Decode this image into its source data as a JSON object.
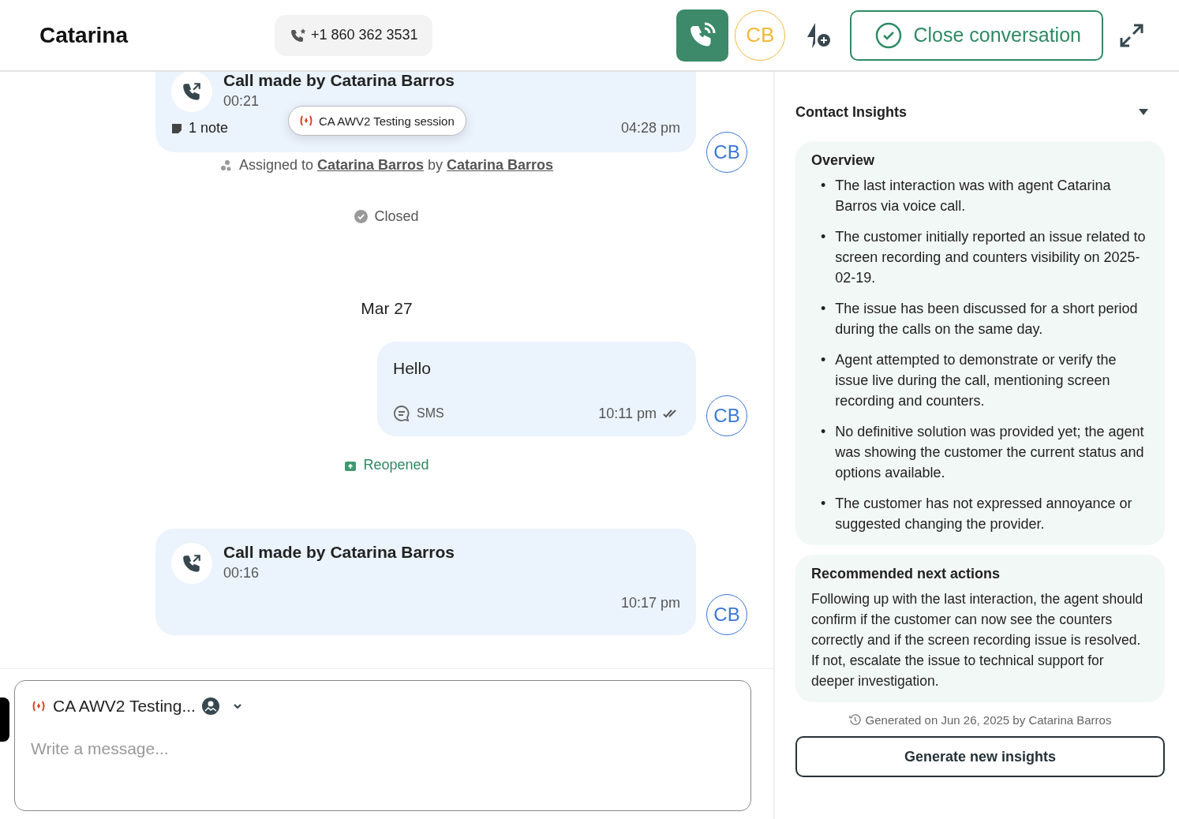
{
  "header": {
    "title": "Catarina",
    "phone": "+1 860 362 3531",
    "call_active": true,
    "agent_initials": "CB",
    "close_button": "Close conversation"
  },
  "timeline": [
    {
      "kind": "call",
      "title": "Call made by Catarina Barros",
      "duration": "00:21",
      "note": "1 note",
      "tag": "CA AWV2 Testing session",
      "time": "04:28 pm",
      "avatar": "CB"
    },
    {
      "kind": "assignment",
      "prefix": "Assigned to",
      "assignee": "Catarina Barros",
      "joiner": "by",
      "assigner": "Catarina Barros"
    },
    {
      "kind": "status",
      "label": "Closed",
      "reopened": false
    },
    {
      "kind": "date",
      "label": "Mar 27"
    },
    {
      "kind": "message",
      "text": "Hello",
      "channel": "SMS",
      "time": "10:11 pm",
      "delivered": true,
      "avatar": "CB"
    },
    {
      "kind": "status",
      "label": "Reopened",
      "reopened": true
    },
    {
      "kind": "call",
      "title": "Call made by Catarina Barros",
      "duration": "00:16",
      "time": "10:17 pm",
      "avatar": "CB"
    }
  ],
  "composer": {
    "channel": "CA AWV2 Testing...",
    "placeholder": "Write a message..."
  },
  "insights": {
    "title": "Contact Insights",
    "expanded": true,
    "overview": {
      "title": "Overview",
      "marker": "•",
      "bullets": [
        "The last interaction was with agent Catarina Barros via voice call.",
        "The customer initially reported an issue related to screen recording and counters visibility on 2025-02-19.",
        "The issue has been discussed for a short period during the calls on the same day.",
        "Agent attempted to demonstrate or verify the issue live during the call, mentioning screen recording and counters.",
        "No definitive solution was provided yet; the agent was showing the customer the current status and options available.",
        "The customer has not expressed annoyance or suggested changing the provider."
      ]
    },
    "next_actions": {
      "title": "Recommended next actions",
      "text": "Following up with the last interaction, the agent should confirm if the customer can now see the counters correctly and if the screen recording issue is resolved. If not, escalate the issue to technical support for deeper investigation."
    },
    "generated": "Generated on Jun 26, 2025 by Catarina Barros",
    "button": "Generate new insights"
  }
}
